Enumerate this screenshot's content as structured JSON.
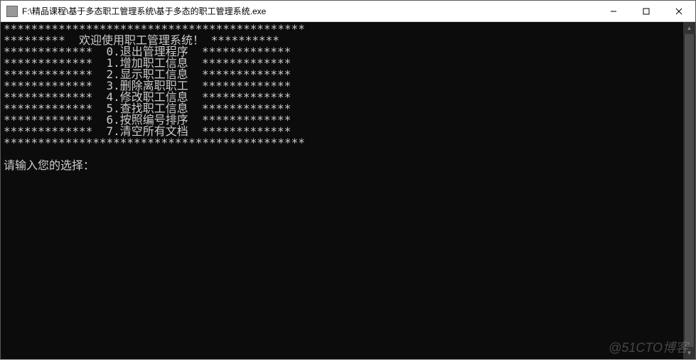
{
  "window": {
    "title": "F:\\精品课程\\基于多态职工管理系统\\基于多态的职工管理系统.exe"
  },
  "console": {
    "border_top": "********************************************",
    "header": "*********  欢迎使用职工管理系统！ **********",
    "row0": "*************  0.退出管理程序  *************",
    "row1": "*************  1.增加职工信息  *************",
    "row2": "*************  2.显示职工信息  *************",
    "row3": "*************  3.删除离职职工  *************",
    "row4": "*************  4.修改职工信息  *************",
    "row5": "*************  5.查找职工信息  *************",
    "row6": "*************  6.按照编号排序  *************",
    "row7": "*************  7.清空所有文档  *************",
    "border_bottom": "********************************************",
    "prompt": "请输入您的选择："
  },
  "watermark": "@51CTO博客"
}
